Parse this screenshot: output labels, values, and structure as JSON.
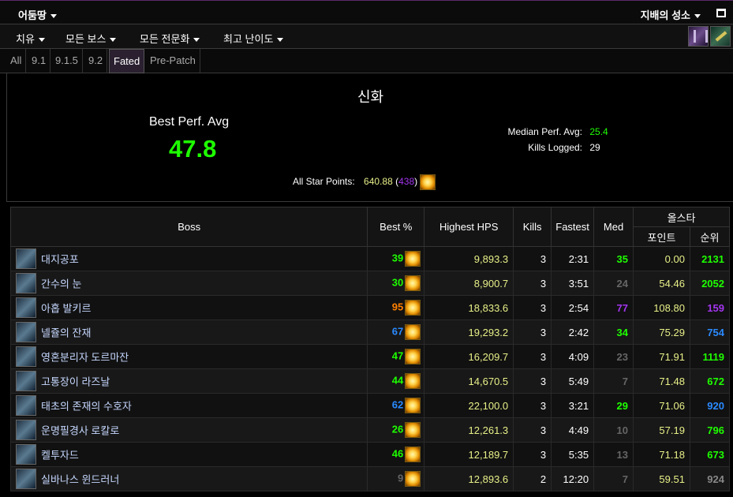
{
  "top": {
    "zone": "어둠땅",
    "raid": "지배의 성소"
  },
  "filters": [
    "치유",
    "모든 보스",
    "모든 전문화",
    "최고 난이도"
  ],
  "tabs": [
    {
      "label": "All",
      "active": false
    },
    {
      "label": "9.1",
      "active": false
    },
    {
      "label": "9.1.5",
      "active": false
    },
    {
      "label": "9.2",
      "active": false
    },
    {
      "label": "Fated",
      "active": true
    },
    {
      "label": "Pre-Patch",
      "active": false
    }
  ],
  "summary": {
    "difficulty": "신화",
    "best_perf_label": "Best Perf. Avg",
    "best_perf_value": "47.8",
    "median_label": "Median Perf. Avg:",
    "median_value": "25.4",
    "kills_label": "Kills Logged:",
    "kills_value": "29",
    "allstar_label": "All Star Points:",
    "allstar_points": "640.88",
    "allstar_rank": "438"
  },
  "table": {
    "headers": {
      "boss": "Boss",
      "best": "Best %",
      "hps": "Highest HPS",
      "kills": "Kills",
      "fastest": "Fastest",
      "med": "Med",
      "allstar": "올스타",
      "points": "포인트",
      "rank": "순위"
    },
    "rows": [
      {
        "boss": "대지공포",
        "best": "39",
        "best_color": "#1eff00",
        "hps": "9,893.3",
        "kills": "3",
        "fastest": "2:31",
        "med": "35",
        "med_color": "#1eff00",
        "points": "0.00",
        "rank": "2131",
        "rank_color": "#1eff00"
      },
      {
        "boss": "간수의 눈",
        "best": "30",
        "best_color": "#1eff00",
        "hps": "8,900.7",
        "kills": "3",
        "fastest": "3:51",
        "med": "24",
        "med_color": "#666666",
        "points": "54.46",
        "rank": "2052",
        "rank_color": "#1eff00"
      },
      {
        "boss": "아홉 발키르",
        "best": "95",
        "best_color": "#ff8000",
        "hps": "18,833.6",
        "kills": "3",
        "fastest": "2:54",
        "med": "77",
        "med_color": "#a335ee",
        "points": "108.80",
        "rank": "159",
        "rank_color": "#a335ee"
      },
      {
        "boss": "넬쥴의 잔재",
        "best": "67",
        "best_color": "#2a8aff",
        "hps": "19,293.2",
        "kills": "3",
        "fastest": "2:42",
        "med": "34",
        "med_color": "#1eff00",
        "points": "75.29",
        "rank": "754",
        "rank_color": "#2a8aff"
      },
      {
        "boss": "영혼분리자 도르마잔",
        "best": "47",
        "best_color": "#1eff00",
        "hps": "16,209.7",
        "kills": "3",
        "fastest": "4:09",
        "med": "23",
        "med_color": "#666666",
        "points": "71.91",
        "rank": "1119",
        "rank_color": "#1eff00"
      },
      {
        "boss": "고통장이 라즈날",
        "best": "44",
        "best_color": "#1eff00",
        "hps": "14,670.5",
        "kills": "3",
        "fastest": "5:49",
        "med": "7",
        "med_color": "#666666",
        "points": "71.48",
        "rank": "672",
        "rank_color": "#1eff00"
      },
      {
        "boss": "태초의 존재의 수호자",
        "best": "62",
        "best_color": "#2a8aff",
        "hps": "22,100.0",
        "kills": "3",
        "fastest": "3:21",
        "med": "29",
        "med_color": "#1eff00",
        "points": "71.06",
        "rank": "920",
        "rank_color": "#2a8aff"
      },
      {
        "boss": "운명필경사 로칼로",
        "best": "26",
        "best_color": "#1eff00",
        "hps": "12,261.3",
        "kills": "3",
        "fastest": "4:49",
        "med": "10",
        "med_color": "#666666",
        "points": "57.19",
        "rank": "796",
        "rank_color": "#1eff00"
      },
      {
        "boss": "켈투자드",
        "best": "46",
        "best_color": "#1eff00",
        "hps": "12,189.7",
        "kills": "3",
        "fastest": "5:35",
        "med": "13",
        "med_color": "#666666",
        "points": "71.18",
        "rank": "673",
        "rank_color": "#1eff00"
      },
      {
        "boss": "실바나스 윈드러너",
        "best": "9",
        "best_color": "#666666",
        "hps": "12,893.6",
        "kills": "2",
        "fastest": "12:20",
        "med": "7",
        "med_color": "#666666",
        "points": "59.51",
        "rank": "924",
        "rank_color": "#888888"
      }
    ]
  },
  "colors": {
    "accent_green": "#1eff00",
    "hps_text": "#e8f088",
    "allstar_points_text": "#e8f088",
    "allstar_rank": "#a335ee"
  }
}
